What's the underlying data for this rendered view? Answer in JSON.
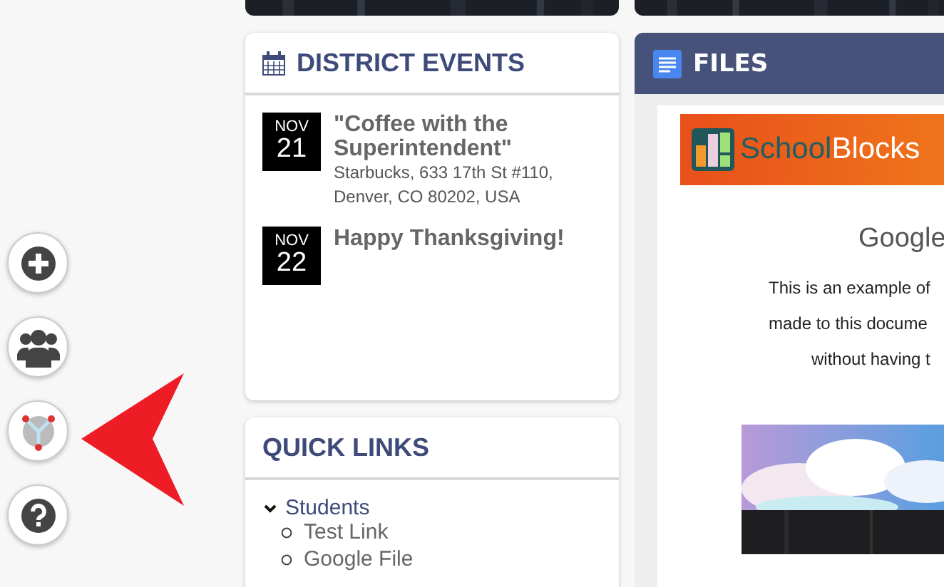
{
  "sidebar": {
    "buttons": [
      {
        "kind": "add"
      },
      {
        "kind": "group"
      },
      {
        "kind": "network"
      },
      {
        "kind": "help"
      }
    ]
  },
  "events": {
    "title": "DISTRICT EVENTS",
    "items": [
      {
        "month": "NOV",
        "day": "21",
        "title": "\"Coffee with the Superintendent\"",
        "location": "Starbucks, 633 17th St #110, Denver, CO 80202, USA"
      },
      {
        "month": "NOV",
        "day": "22",
        "title": "Happy Thanksgiving!"
      }
    ]
  },
  "quick_links": {
    "title": "QUICK LINKS",
    "groups": [
      {
        "label": "Students",
        "expanded": true,
        "children": [
          {
            "label": "Test Link"
          },
          {
            "label": "Google File"
          }
        ]
      }
    ]
  },
  "files": {
    "title": "FILES",
    "document": {
      "banner": {
        "first": "School",
        "second": "Blocks"
      },
      "heading": "Google",
      "lines": [
        "This is an example of",
        "made to this docume",
        "without having t"
      ]
    }
  }
}
